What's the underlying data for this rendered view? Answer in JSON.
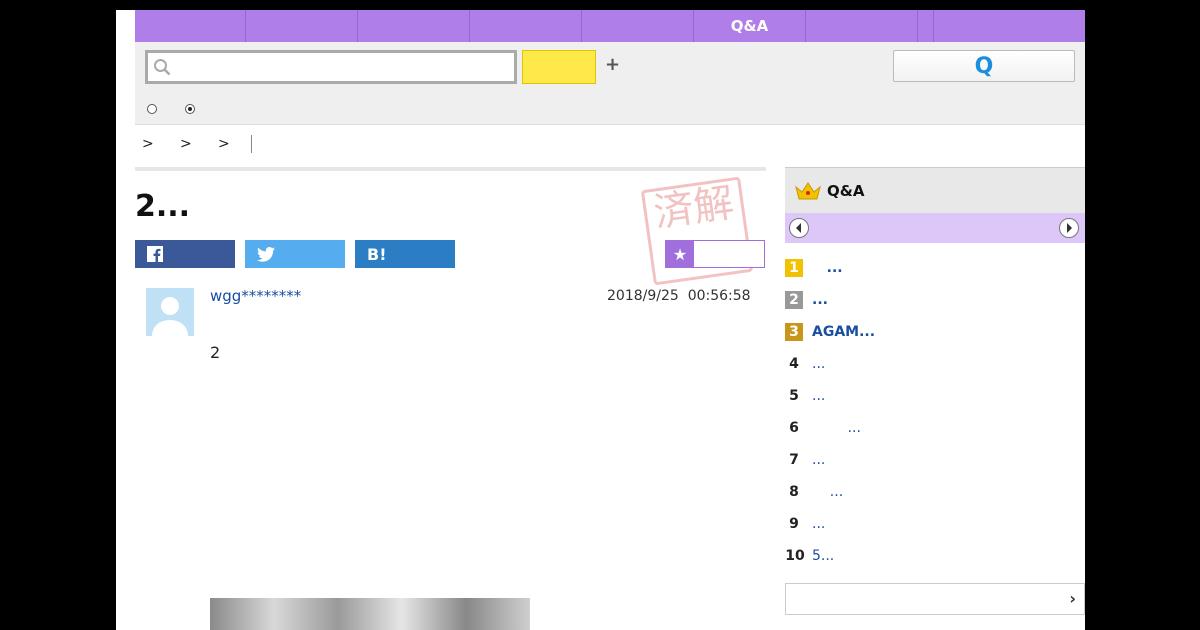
{
  "nav": {
    "items": [
      "",
      "",
      "",
      "",
      "",
      "Q&A",
      "",
      "",
      ""
    ]
  },
  "search": {
    "placeholder": "",
    "button_label": "",
    "plus": "+",
    "q_button": "Q"
  },
  "breadcrumb": [
    ">",
    ">",
    ">"
  ],
  "question": {
    "title": "2...",
    "stamp": "済解",
    "share": {
      "facebook": "f",
      "twitter": "t",
      "hatena": "B!"
    },
    "favorite_label": "",
    "author": "wgg********",
    "date": "2018/9/25",
    "time": "00:56:58",
    "body": "2"
  },
  "ranking": {
    "title": "Q&A",
    "items": [
      {
        "rank": "1",
        "text": "   ...",
        "style": "gold",
        "bold": true
      },
      {
        "rank": "2",
        "text": "...",
        "style": "silver",
        "bold": true
      },
      {
        "rank": "3",
        "text": "AGAM...",
        "style": "bronze",
        "bold": true
      },
      {
        "rank": "4",
        "text": "...",
        "style": "plain",
        "bold": false
      },
      {
        "rank": "5",
        "text": "...",
        "style": "plain",
        "bold": false
      },
      {
        "rank": "6",
        "text": "        ...",
        "style": "plain",
        "bold": false
      },
      {
        "rank": "7",
        "text": "...",
        "style": "plain",
        "bold": false
      },
      {
        "rank": "8",
        "text": "    ...",
        "style": "plain",
        "bold": false
      },
      {
        "rank": "9",
        "text": "...",
        "style": "plain",
        "bold": false
      },
      {
        "rank": "10",
        "text": "5...",
        "style": "plain",
        "bold": false
      }
    ]
  },
  "colors": {
    "nav": "#b07ee8",
    "accent_blue": "#1a4fa0",
    "search_button": "#ffe84a",
    "tab_bar": "#dcc7f8"
  }
}
